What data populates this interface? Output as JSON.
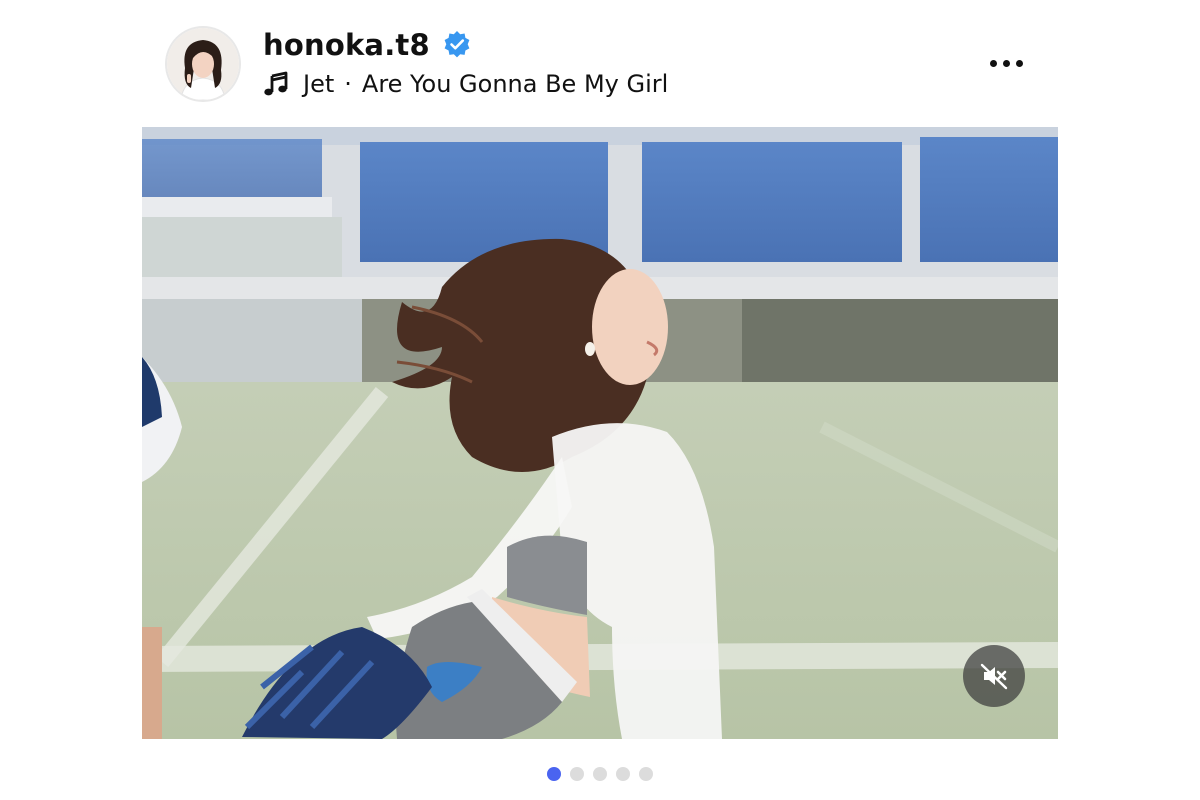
{
  "post": {
    "username": "honoka.t8",
    "verified": true,
    "music": {
      "artist": "Jet",
      "separator": "·",
      "title": "Are You Gonna Be My Girl"
    },
    "icons": {
      "avatar": "profile-photo",
      "verified": "verified-badge-icon",
      "music": "music-note-icon",
      "more": "more-options-icon",
      "mute": "speaker-muted-icon"
    },
    "media": {
      "type": "photo",
      "audio_muted": true
    },
    "carousel": {
      "total": 5,
      "active_index": 0
    },
    "colors": {
      "verified_badge": "#3897f0",
      "active_dot": "#4a64f0",
      "inactive_dot": "#dcdcdc"
    }
  }
}
